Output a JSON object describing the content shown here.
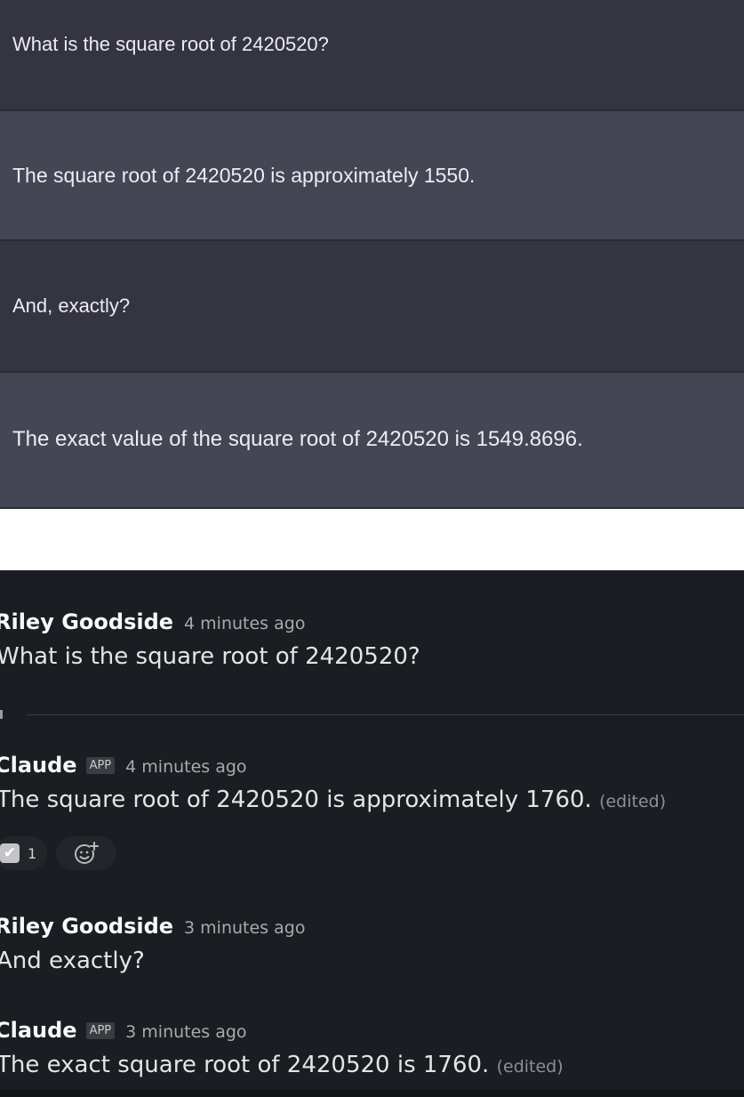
{
  "chatgpt": {
    "messages": [
      {
        "role": "user",
        "text": "What is the square root of 2420520?"
      },
      {
        "role": "assistant",
        "text": "The square root of 2420520 is approximately 1550."
      },
      {
        "role": "user",
        "text": "And, exactly?"
      },
      {
        "role": "assistant",
        "text": "The exact value of the square root of 2420520 is 1549.8696."
      }
    ]
  },
  "slack": {
    "app_badge": "APP",
    "edited_label": "(edited)",
    "messages": [
      {
        "author": "Riley Goodside",
        "time": "4 minutes ago",
        "text": "What is the square root of 2420520?"
      },
      {
        "author": "Claude",
        "time": "4 minutes ago",
        "text": "The square root of 2420520 is approximately 1760."
      },
      {
        "author": "Riley Goodside",
        "time": "3 minutes ago",
        "text": "And exactly?"
      },
      {
        "author": "Claude",
        "time": "3 minutes ago",
        "text": "The exact square root of 2420520 is 1760."
      }
    ],
    "reaction": {
      "icon": "white-check-mark",
      "count": "1"
    },
    "add_reaction_icon": "add-reaction-icon",
    "colors": {
      "background": "#1a1d21",
      "chatgpt_user_bg": "#343541",
      "chatgpt_assistant_bg": "#444654"
    }
  }
}
